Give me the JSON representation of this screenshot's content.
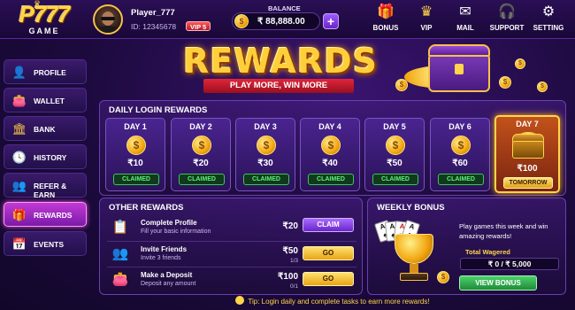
{
  "header": {
    "logo_main": "P777",
    "logo_sub": "GAME",
    "player_name": "Player_777",
    "player_id": "ID: 12345678",
    "vip_badge": "VIP 5",
    "balance_label": "BALANCE",
    "balance_value": "₹ 88,888.00",
    "add_symbol": "+",
    "nav": [
      {
        "label": "BONUS",
        "icon": "gift-icon"
      },
      {
        "label": "VIP",
        "icon": "crown-icon"
      },
      {
        "label": "MAIL",
        "icon": "mail-icon"
      },
      {
        "label": "SUPPORT",
        "icon": "headset-icon"
      },
      {
        "label": "SETTING",
        "icon": "gear-icon"
      }
    ]
  },
  "sidebar": {
    "items": [
      {
        "label": "PROFILE",
        "icon": "user-icon"
      },
      {
        "label": "WALLET",
        "icon": "wallet-icon"
      },
      {
        "label": "BANK",
        "icon": "bank-icon"
      },
      {
        "label": "HISTORY",
        "icon": "clock-icon"
      },
      {
        "label": "REFER & EARN",
        "icon": "users-icon"
      },
      {
        "label": "REWARDS",
        "icon": "gift-icon",
        "active": true
      },
      {
        "label": "EVENTS",
        "icon": "calendar-icon"
      }
    ]
  },
  "banner": {
    "title": "REWARDS",
    "subtitle": "PLAY MORE, WIN MORE"
  },
  "daily": {
    "title": "DAILY LOGIN REWARDS",
    "days": [
      {
        "label": "DAY 1",
        "amount": "₹10",
        "status": "CLAIMED"
      },
      {
        "label": "DAY 2",
        "amount": "₹20",
        "status": "CLAIMED"
      },
      {
        "label": "DAY 3",
        "amount": "₹30",
        "status": "CLAIMED"
      },
      {
        "label": "DAY 4",
        "amount": "₹40",
        "status": "CLAIMED"
      },
      {
        "label": "DAY 5",
        "amount": "₹50",
        "status": "CLAIMED"
      },
      {
        "label": "DAY 6",
        "amount": "₹60",
        "status": "CLAIMED"
      },
      {
        "label": "DAY 7",
        "amount": "₹100",
        "status": "TOMORROW"
      }
    ]
  },
  "other_rewards": {
    "title": "OTHER REWARDS",
    "tasks": [
      {
        "name": "Complete Profile",
        "desc": "Fill your basic information",
        "reward": "₹20",
        "progress": "",
        "button": "CLAIM",
        "icon": "clipboard-icon"
      },
      {
        "name": "Invite Friends",
        "desc": "Invite 3 friends",
        "reward": "₹50",
        "progress": "1/3",
        "button": "GO",
        "icon": "add-user-icon"
      },
      {
        "name": "Make a Deposit",
        "desc": "Deposit any amount",
        "reward": "₹100",
        "progress": "0/1",
        "button": "GO",
        "icon": "wallet-icon"
      }
    ]
  },
  "weekly": {
    "title": "WEEKLY BONUS",
    "description": "Play games this week and win amazing rewards!",
    "wager_label": "Total Wagered",
    "wager_value": "₹ 0 / ₹ 5,000",
    "button": "VIEW BONUS"
  },
  "tip": "Tip: Login daily and complete tasks to earn more rewards!",
  "colors": {
    "accent_gold": "#ffd54a",
    "accent_purple": "#6a25c9",
    "claimed_green": "#5ff07a",
    "active_pink": "#c23ad6"
  }
}
